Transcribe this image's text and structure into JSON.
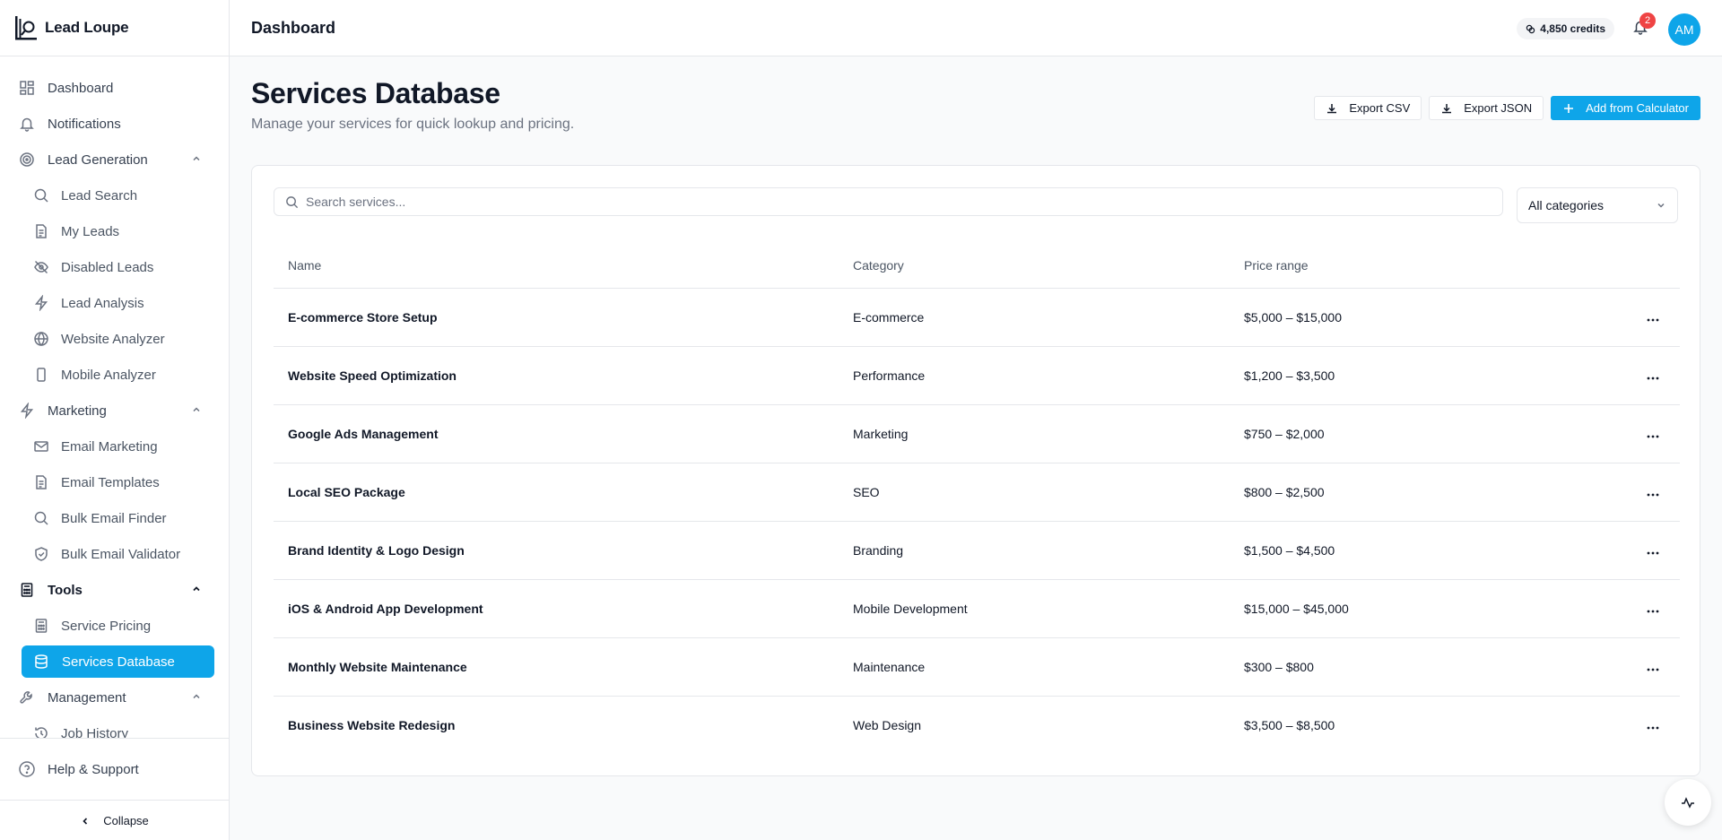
{
  "app": {
    "name": "Lead Loupe"
  },
  "header": {
    "title": "Dashboard",
    "credits": "4,850 credits",
    "notification_count": "2",
    "avatar_initials": "AM"
  },
  "sidebar": {
    "dashboard": "Dashboard",
    "notifications": "Notifications",
    "lead_generation": "Lead Generation",
    "lead_search": "Lead Search",
    "my_leads": "My Leads",
    "disabled_leads": "Disabled Leads",
    "lead_analysis": "Lead Analysis",
    "website_analyzer": "Website Analyzer",
    "mobile_analyzer": "Mobile Analyzer",
    "marketing": "Marketing",
    "email_marketing": "Email Marketing",
    "email_templates": "Email Templates",
    "bulk_email_finder": "Bulk Email Finder",
    "bulk_email_validator": "Bulk Email Validator",
    "tools": "Tools",
    "service_pricing": "Service Pricing",
    "services_database": "Services Database",
    "management": "Management",
    "job_history": "Job History",
    "help": "Help & Support",
    "collapse": "Collapse"
  },
  "main": {
    "title": "Services Database",
    "subtitle": "Manage your services for quick lookup and pricing.",
    "export_csv": "Export CSV",
    "export_json": "Export JSON",
    "add_from_calculator": "Add from Calculator",
    "search_placeholder": "Search services...",
    "category_filter": "All categories",
    "columns": {
      "name": "Name",
      "category": "Category",
      "price": "Price range"
    },
    "rows": [
      {
        "name": "E-commerce Store Setup",
        "category": "E-commerce",
        "price": "$5,000 – $15,000"
      },
      {
        "name": "Website Speed Optimization",
        "category": "Performance",
        "price": "$1,200 – $3,500"
      },
      {
        "name": "Google Ads Management",
        "category": "Marketing",
        "price": "$750 – $2,000"
      },
      {
        "name": "Local SEO Package",
        "category": "SEO",
        "price": "$800 – $2,500"
      },
      {
        "name": "Brand Identity & Logo Design",
        "category": "Branding",
        "price": "$1,500 – $4,500"
      },
      {
        "name": "iOS & Android App Development",
        "category": "Mobile Development",
        "price": "$15,000 – $45,000"
      },
      {
        "name": "Monthly Website Maintenance",
        "category": "Maintenance",
        "price": "$300 – $800"
      },
      {
        "name": "Business Website Redesign",
        "category": "Web Design",
        "price": "$3,500 – $8,500"
      }
    ]
  },
  "colors": {
    "accent": "#0ea5e9",
    "badge": "#ef4444"
  }
}
